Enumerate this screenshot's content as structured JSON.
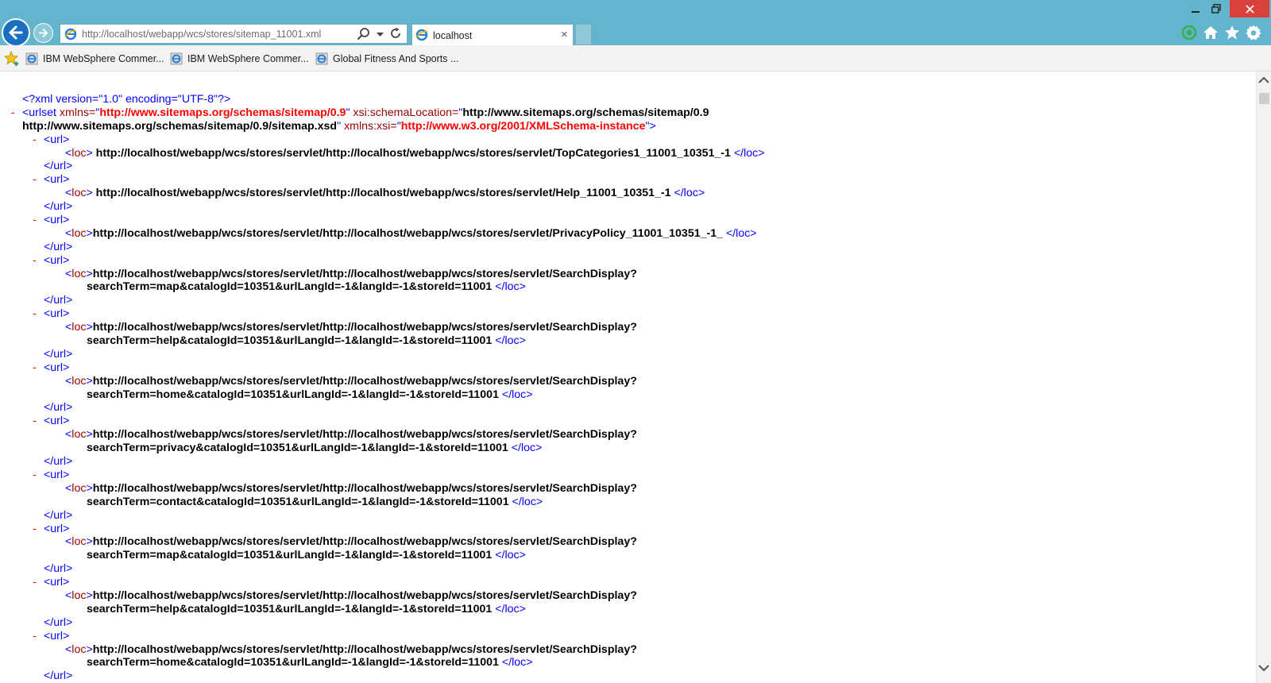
{
  "browser": {
    "address_url": "http://localhost/webapp/wcs/stores/sitemap_11001.xml",
    "tab_title": "localhost",
    "tab_close": "×",
    "window_controls": {
      "minimize": "–",
      "maximize": "❐",
      "close": "✕"
    },
    "favorites": [
      {
        "label": "IBM WebSphere Commer..."
      },
      {
        "label": "IBM WebSphere Commer..."
      },
      {
        "label": "Global Fitness And Sports ..."
      }
    ],
    "icons": [
      "back-arrow-icon",
      "forward-arrow-icon",
      "ie-favicon-icon",
      "search-icon",
      "dropdown-icon",
      "refresh-icon",
      "green-addon-icon",
      "home-icon",
      "favorites-star-icon",
      "settings-gear-icon",
      "add-to-favorites-star-icon"
    ],
    "colors": {
      "titlebar": "#62b5cc",
      "back_button": "#1a6fc0",
      "close_button": "#d9413a"
    }
  },
  "xml": {
    "declaration": "<?xml version=\"1.0\" encoding=\"UTF-8\"?>",
    "collapse_marker": "-",
    "urlset": {
      "open_tag": "<urlset",
      "xmlns_attr": " xmlns=",
      "xmlns_value": "http://www.sitemaps.org/schemas/sitemap/0.9",
      "schema_attr": " xsi:schemaLocation=",
      "schema_value_line1": "http://www.sitemaps.org/schemas/sitemap/0.9",
      "schema_value_line2": "http://www.sitemaps.org/schemas/sitemap/0.9/sitemap.xsd",
      "xsi_attr": " xmlns:xsi=",
      "xsi_value": "http://www.w3.org/2001/XMLSchema-instance",
      "quote": "\"",
      "close_bracket": ">"
    },
    "tags": {
      "url_open": "<url>",
      "url_close": "</url>",
      "loc_open": "<loc>",
      "loc_close": "</loc>",
      "lt": "<",
      "gt": ">"
    },
    "entries": [
      {
        "line1": " http://localhost/webapp/wcs/stores/servlet/http://localhost/webapp/wcs/stores/servlet/TopCategories1_11001_10351_-1 ",
        "line2": ""
      },
      {
        "line1": " http://localhost/webapp/wcs/stores/servlet/http://localhost/webapp/wcs/stores/servlet/Help_11001_10351_-1 ",
        "line2": ""
      },
      {
        "line1": "http://localhost/webapp/wcs/stores/servlet/http://localhost/webapp/wcs/stores/servlet/PrivacyPolicy_11001_10351_-1_ ",
        "line2": ""
      },
      {
        "line1": "http://localhost/webapp/wcs/stores/servlet/http://localhost/webapp/wcs/stores/servlet/SearchDisplay?",
        "line2": "searchTerm=map&catalogId=10351&urlLangId=-1&langId=-1&storeId=11001 "
      },
      {
        "line1": "http://localhost/webapp/wcs/stores/servlet/http://localhost/webapp/wcs/stores/servlet/SearchDisplay?",
        "line2": "searchTerm=help&catalogId=10351&urlLangId=-1&langId=-1&storeId=11001 "
      },
      {
        "line1": "http://localhost/webapp/wcs/stores/servlet/http://localhost/webapp/wcs/stores/servlet/SearchDisplay?",
        "line2": "searchTerm=home&catalogId=10351&urlLangId=-1&langId=-1&storeId=11001 "
      },
      {
        "line1": "http://localhost/webapp/wcs/stores/servlet/http://localhost/webapp/wcs/stores/servlet/SearchDisplay?",
        "line2": "searchTerm=privacy&catalogId=10351&urlLangId=-1&langId=-1&storeId=11001 "
      },
      {
        "line1": "http://localhost/webapp/wcs/stores/servlet/http://localhost/webapp/wcs/stores/servlet/SearchDisplay?",
        "line2": "searchTerm=contact&catalogId=10351&urlLangId=-1&langId=-1&storeId=11001 "
      },
      {
        "line1": "http://localhost/webapp/wcs/stores/servlet/http://localhost/webapp/wcs/stores/servlet/SearchDisplay?",
        "line2": "searchTerm=map&catalogId=10351&urlLangId=-1&langId=-1&storeId=11001 "
      },
      {
        "line1": "http://localhost/webapp/wcs/stores/servlet/http://localhost/webapp/wcs/stores/servlet/SearchDisplay?",
        "line2": "searchTerm=help&catalogId=10351&urlLangId=-1&langId=-1&storeId=11001 "
      },
      {
        "line1": "http://localhost/webapp/wcs/stores/servlet/http://localhost/webapp/wcs/stores/servlet/SearchDisplay?",
        "line2": "searchTerm=home&catalogId=10351&urlLangId=-1&langId=-1&storeId=11001 "
      }
    ]
  }
}
